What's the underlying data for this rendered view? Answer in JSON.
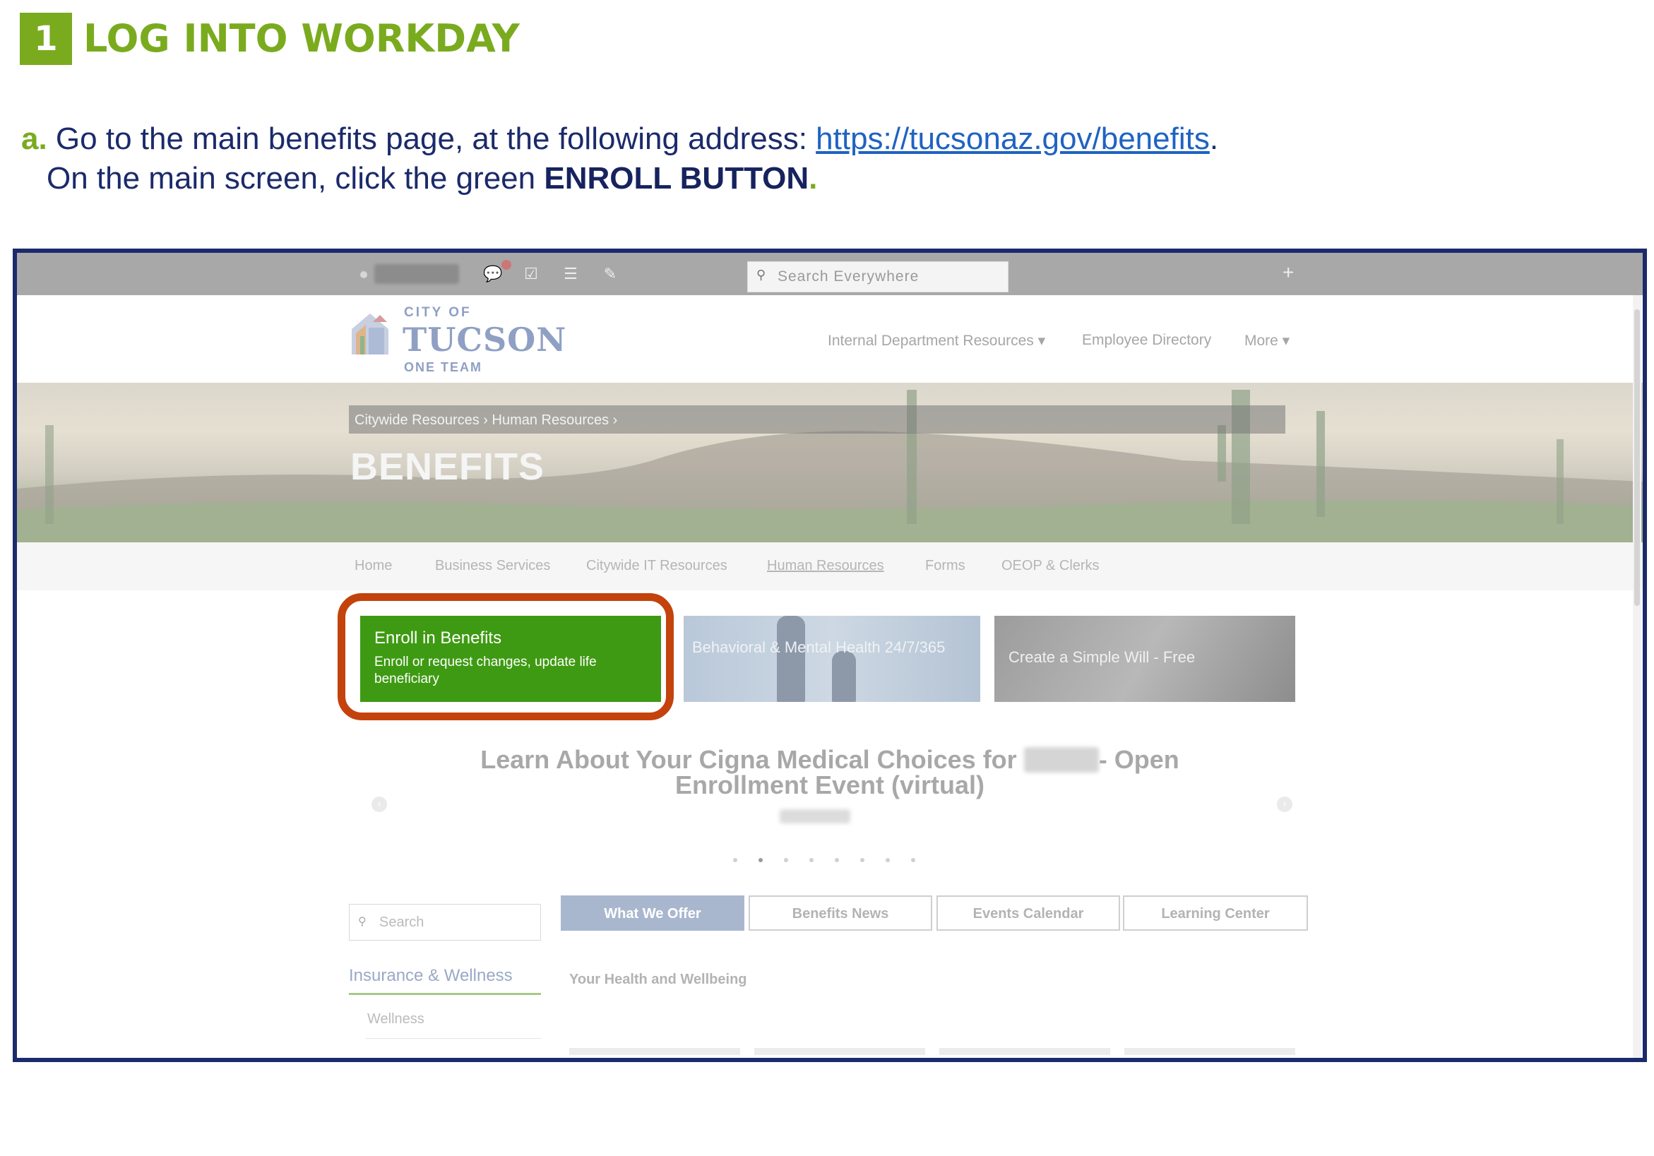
{
  "header": {
    "step_number": "1",
    "step_title": "LOG INTO WORKDAY"
  },
  "instruction": {
    "letter": "a.",
    "line1_text": " Go to the main benefits page, at the following address: ",
    "link_text": "https://tucsonaz.gov/benefits",
    "line1_end": ".",
    "line2_text": "On the main screen, click the green ",
    "emphasis": "ENROLL BUTTON",
    "line2_end": "."
  },
  "browser": {
    "search_placeholder": "Search Everywhere",
    "plus_label": "+"
  },
  "site": {
    "logo_city_of": "CITY OF",
    "logo_tucson": "TUCSON",
    "logo_team": "ONE TEAM",
    "top_nav": [
      {
        "label": "Internal Department Resources ▾"
      },
      {
        "label": "Employee Directory"
      },
      {
        "label": "More ▾"
      }
    ],
    "breadcrumb": "Citywide Resources › Human Resources ›",
    "page_title": "BENEFITS",
    "sub_nav": [
      {
        "label": "Home"
      },
      {
        "label": "Business Services"
      },
      {
        "label": "Citywide IT Resources"
      },
      {
        "label": "Human Resources"
      },
      {
        "label": "Forms"
      },
      {
        "label": "OEOP & Clerks"
      }
    ],
    "tiles": {
      "enroll_title": "Enroll in Benefits",
      "enroll_sub": "Enroll or request changes, update life beneficiary",
      "mental_title": "Behavioral & Mental Health 24/7/365",
      "will_title": "Create a Simple Will - Free"
    },
    "slide": {
      "title_a": "Learn About Your Cigna Medical Choices for ",
      "title_b": "- Open",
      "title_c": "Enrollment Event (virtual)"
    },
    "search_placeholder": "Search",
    "tabs": [
      {
        "label": "What We Offer"
      },
      {
        "label": "Benefits News"
      },
      {
        "label": "Events Calendar"
      },
      {
        "label": "Learning Center"
      }
    ],
    "sidebar_heading": "Insurance & Wellness",
    "sidebar_item": "Wellness",
    "content_heading": "Your Health and Wellbeing"
  },
  "colors": {
    "accent_green": "#7aab1e",
    "navy": "#1b2a6b",
    "highlight_orange": "#c4420c",
    "enroll_green": "#3e9a12"
  }
}
